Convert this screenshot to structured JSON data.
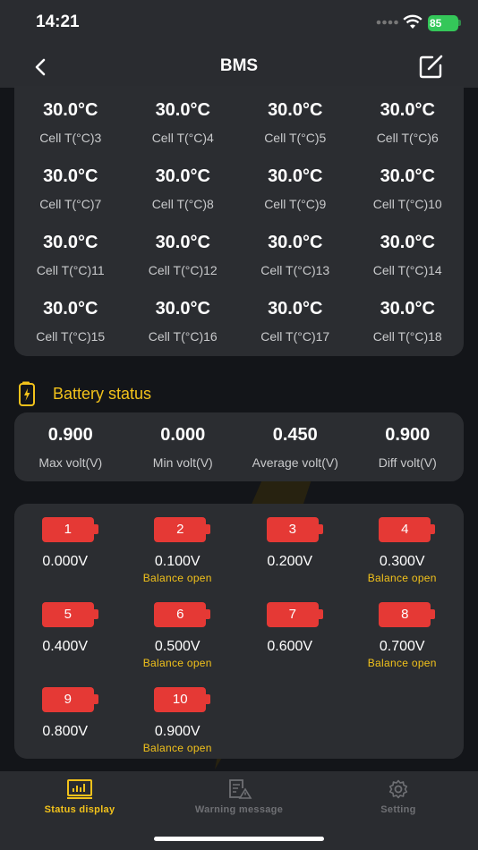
{
  "status_bar": {
    "time": "14:21",
    "battery": "85"
  },
  "nav": {
    "title": "BMS"
  },
  "temperatures": [
    {
      "value": "30.0°C",
      "label": "Cell T(°C)3"
    },
    {
      "value": "30.0°C",
      "label": "Cell T(°C)4"
    },
    {
      "value": "30.0°C",
      "label": "Cell T(°C)5"
    },
    {
      "value": "30.0°C",
      "label": "Cell T(°C)6"
    },
    {
      "value": "30.0°C",
      "label": "Cell T(°C)7"
    },
    {
      "value": "30.0°C",
      "label": "Cell T(°C)8"
    },
    {
      "value": "30.0°C",
      "label": "Cell T(°C)9"
    },
    {
      "value": "30.0°C",
      "label": "Cell T(°C)10"
    },
    {
      "value": "30.0°C",
      "label": "Cell T(°C)11"
    },
    {
      "value": "30.0°C",
      "label": "Cell T(°C)12"
    },
    {
      "value": "30.0°C",
      "label": "Cell T(°C)13"
    },
    {
      "value": "30.0°C",
      "label": "Cell T(°C)14"
    },
    {
      "value": "30.0°C",
      "label": "Cell T(°C)15"
    },
    {
      "value": "30.0°C",
      "label": "Cell T(°C)16"
    },
    {
      "value": "30.0°C",
      "label": "Cell T(°C)17"
    },
    {
      "value": "30.0°C",
      "label": "Cell T(°C)18"
    }
  ],
  "battery_status": {
    "title": "Battery status",
    "stats": [
      {
        "value": "0.900",
        "label": "Max volt(V)"
      },
      {
        "value": "0.000",
        "label": "Min volt(V)"
      },
      {
        "value": "0.450",
        "label": "Average volt(V)"
      },
      {
        "value": "0.900",
        "label": "Diff volt(V)"
      }
    ]
  },
  "cells": [
    {
      "num": "1",
      "volt": "0.000V",
      "balance": ""
    },
    {
      "num": "2",
      "volt": "0.100V",
      "balance": "Balance open"
    },
    {
      "num": "3",
      "volt": "0.200V",
      "balance": ""
    },
    {
      "num": "4",
      "volt": "0.300V",
      "balance": "Balance open"
    },
    {
      "num": "5",
      "volt": "0.400V",
      "balance": ""
    },
    {
      "num": "6",
      "volt": "0.500V",
      "balance": "Balance open"
    },
    {
      "num": "7",
      "volt": "0.600V",
      "balance": ""
    },
    {
      "num": "8",
      "volt": "0.700V",
      "balance": "Balance open"
    },
    {
      "num": "9",
      "volt": "0.800V",
      "balance": ""
    },
    {
      "num": "10",
      "volt": "0.900V",
      "balance": "Balance open"
    }
  ],
  "tabs": [
    {
      "label": "Status display",
      "icon": "chart-icon",
      "active": true
    },
    {
      "label": "Warning message",
      "icon": "warning-doc-icon",
      "active": false
    },
    {
      "label": "Setting",
      "icon": "gear-icon",
      "active": false
    }
  ],
  "colors": {
    "accent": "#f2c21b",
    "cell_red": "#e53935",
    "card": "#2b2d31",
    "background": "#131519"
  }
}
